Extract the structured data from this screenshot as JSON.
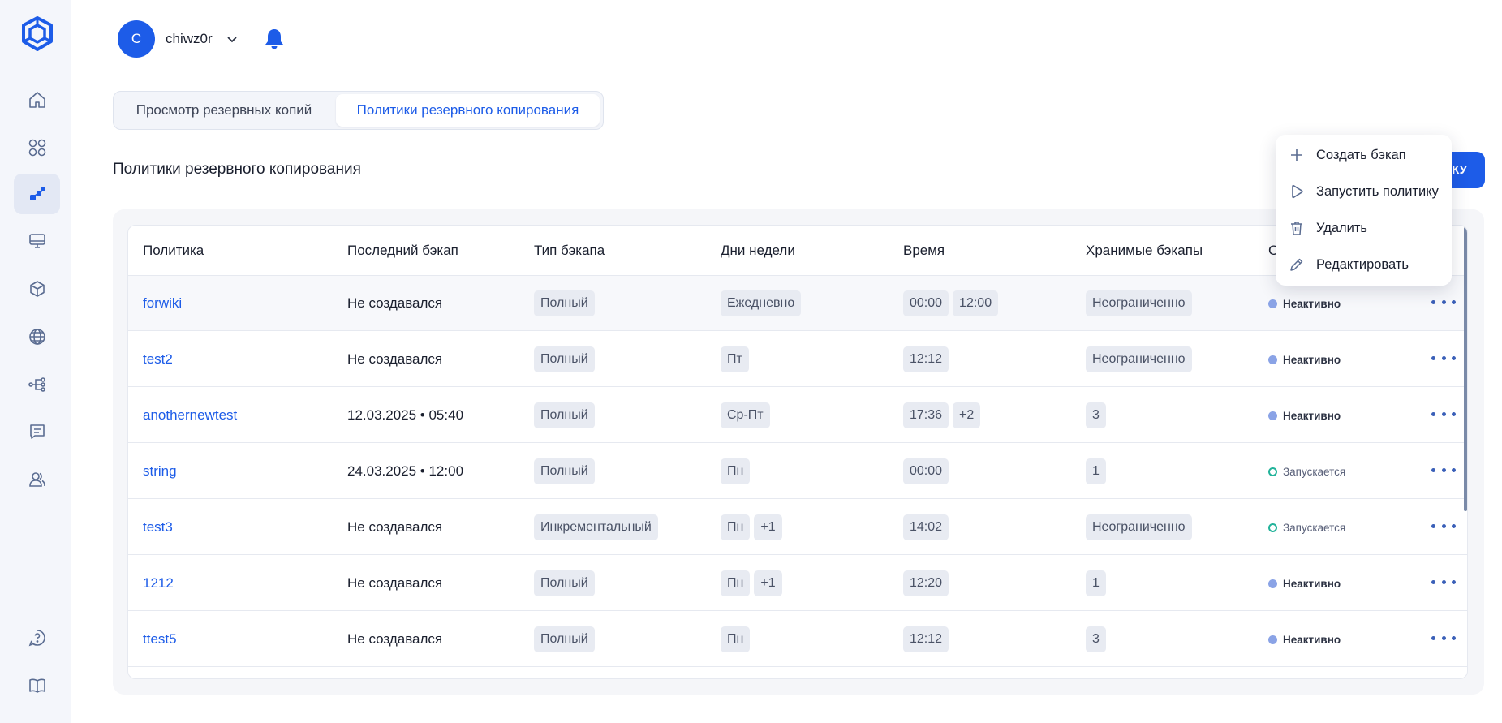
{
  "header": {
    "avatar_letter": "C",
    "username": "chiwz0r"
  },
  "tabs": [
    {
      "label": "Просмотр резервных копий"
    },
    {
      "label": "Политики резервного копирования"
    }
  ],
  "section_title": "Политики резервного копирования",
  "create_button_label": "КУ",
  "table": {
    "columns": [
      "Политика",
      "Последний бэкап",
      "Тип бэкапа",
      "Дни недели",
      "Время",
      "Хранимые бэкапы",
      "С"
    ],
    "rows": [
      {
        "policy": "forwiki",
        "last": "Не создавался",
        "type": "Полный",
        "days": [
          "Ежедневно"
        ],
        "times": [
          "00:00",
          "12:00"
        ],
        "stored": "Неограниченно",
        "status": "Неактивно"
      },
      {
        "policy": "test2",
        "last": "Не создавался",
        "type": "Полный",
        "days": [
          "Пт"
        ],
        "times": [
          "12:12"
        ],
        "stored": "Неограниченно",
        "status": "Неактивно"
      },
      {
        "policy": "anothernewtest",
        "last": "12.03.2025 • 05:40",
        "type": "Полный",
        "days": [
          "Ср-Пт"
        ],
        "times": [
          "17:36",
          "+2"
        ],
        "stored": "3",
        "status": "Неактивно"
      },
      {
        "policy": "string",
        "last": "24.03.2025 • 12:00",
        "type": "Полный",
        "days": [
          "Пн"
        ],
        "times": [
          "00:00"
        ],
        "stored": "1",
        "status": "Запускается"
      },
      {
        "policy": "test3",
        "last": "Не создавался",
        "type": "Инкрементальный",
        "days": [
          "Пн",
          "+1"
        ],
        "times": [
          "14:02"
        ],
        "stored": "Неограниченно",
        "status": "Запускается"
      },
      {
        "policy": "1212",
        "last": "Не создавался",
        "type": "Полный",
        "days": [
          "Пн",
          "+1"
        ],
        "times": [
          "12:20"
        ],
        "stored": "1",
        "status": "Неактивно"
      },
      {
        "policy": "ttest5",
        "last": "Не создавался",
        "type": "Полный",
        "days": [
          "Пн"
        ],
        "times": [
          "12:12"
        ],
        "stored": "3",
        "status": "Неактивно"
      }
    ]
  },
  "context_menu": [
    {
      "label": "Создать бэкап",
      "icon": "plus-icon"
    },
    {
      "label": "Запустить политику",
      "icon": "play-icon"
    },
    {
      "label": "Удалить",
      "icon": "trash-icon"
    },
    {
      "label": "Редактировать",
      "icon": "pencil-icon"
    }
  ],
  "colors": {
    "accent": "#1d5ce8",
    "inactive_dot": "#8aa3e6",
    "starting_dot": "#22b39a"
  }
}
